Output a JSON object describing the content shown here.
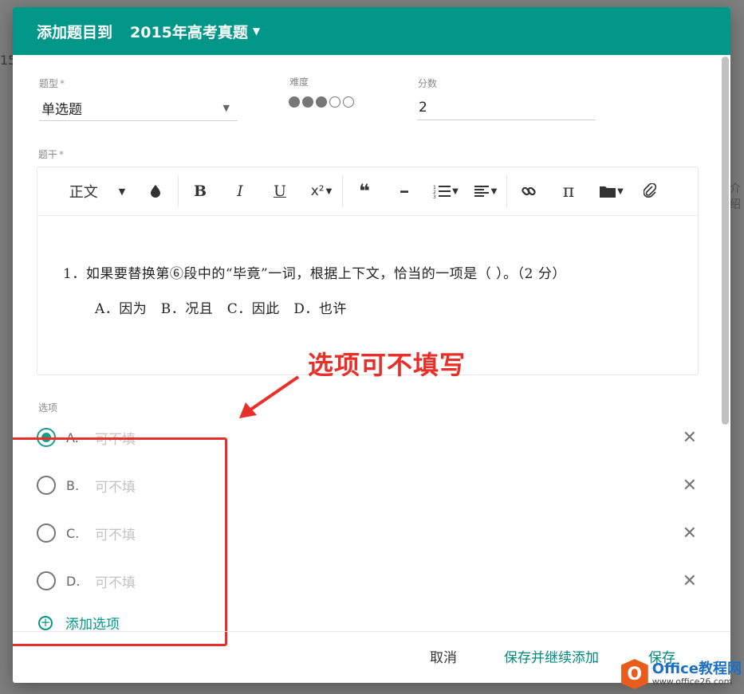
{
  "background": {
    "left_fragment": "15",
    "right_fragment": "介绍"
  },
  "dialog": {
    "title": "添加题目到",
    "collection": "2015年高考真题"
  },
  "form": {
    "type_label": "题型",
    "required_mark": "*",
    "type_value": "单选题",
    "difficulty_label": "难度",
    "difficulty": {
      "level": 3,
      "max": 5
    },
    "score_label": "分数",
    "score_value": "2",
    "stem_label": "题干"
  },
  "toolbar": {
    "paragraph": "正文",
    "bold": "B",
    "italic": "I",
    "underline": "U",
    "superscript": "x²",
    "quote": "❝",
    "hr": "━",
    "math": "π"
  },
  "editor": {
    "question": "1．如果要替换第⑥段中的“毕竟”一词，根据上下文，恰当的一项是（ ）。（2 分）",
    "choices": "A．因为　B．况且　C．因此　D．也许"
  },
  "annotation": {
    "text": "选项可不填写"
  },
  "options": {
    "label": "选项",
    "items": [
      {
        "letter": "A.",
        "placeholder": "可不填",
        "checked": true
      },
      {
        "letter": "B.",
        "placeholder": "可不填",
        "checked": false
      },
      {
        "letter": "C.",
        "placeholder": "可不填",
        "checked": false
      },
      {
        "letter": "D.",
        "placeholder": "可不填",
        "checked": false
      }
    ],
    "add_label": "添加选项"
  },
  "footer": {
    "cancel": "取消",
    "save_continue": "保存并继续添加",
    "save": "保存"
  },
  "watermark": {
    "title": "Office教程网",
    "url": "www.office26.com"
  },
  "colors": {
    "primary": "#009688",
    "annotation": "#e8302a"
  }
}
